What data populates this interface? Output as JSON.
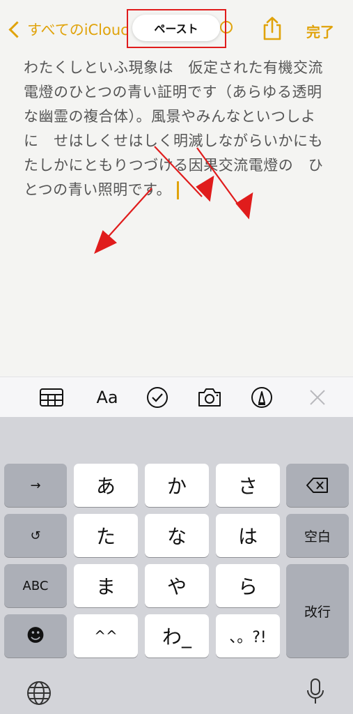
{
  "nav": {
    "back_label": "すべてのiClouc",
    "paste_label": "ペースト",
    "done_label": "完了"
  },
  "note": {
    "lines": [
      "わたくしといふ現象は　仮定された有機交流",
      "電燈のひとつの青い証明です（あらゆる透明",
      "な幽霊の複合体）。風景やみんなといつしよ",
      "に　せはしくせはしく明滅しながらいかにも",
      "たしかにともりつづける因果交流電燈の　ひ",
      "とつの青い照明です。"
    ]
  },
  "toolbar": {
    "icons": [
      "table-icon",
      "text-format-icon",
      "checklist-icon",
      "camera-icon",
      "markup-icon",
      "close-icon"
    ],
    "format_label": "Aa"
  },
  "keyboard": {
    "rows": [
      [
        "→",
        "あ",
        "か",
        "さ",
        "⌫"
      ],
      [
        "↺",
        "た",
        "な",
        "は",
        "空白"
      ],
      [
        "ABC",
        "ま",
        "や",
        "ら",
        "改行"
      ],
      [
        "☻",
        "^^",
        "わ_",
        "、。?!"
      ]
    ],
    "arrow_key": "→",
    "undo_key": "↺",
    "abc_key": "ABC",
    "emoji_key": "☻",
    "space_key": "空白",
    "return_key": "改行",
    "kana": {
      "a": "あ",
      "ka": "か",
      "sa": "さ",
      "ta": "た",
      "na": "な",
      "ha": "は",
      "ma": "ま",
      "ya": "や",
      "ra": "ら",
      "wa": "わ_",
      "kaomoji": "^^",
      "punct": "、。?!"
    }
  },
  "colors": {
    "accent": "#e0a30b",
    "annotation": "#e01c1c"
  }
}
